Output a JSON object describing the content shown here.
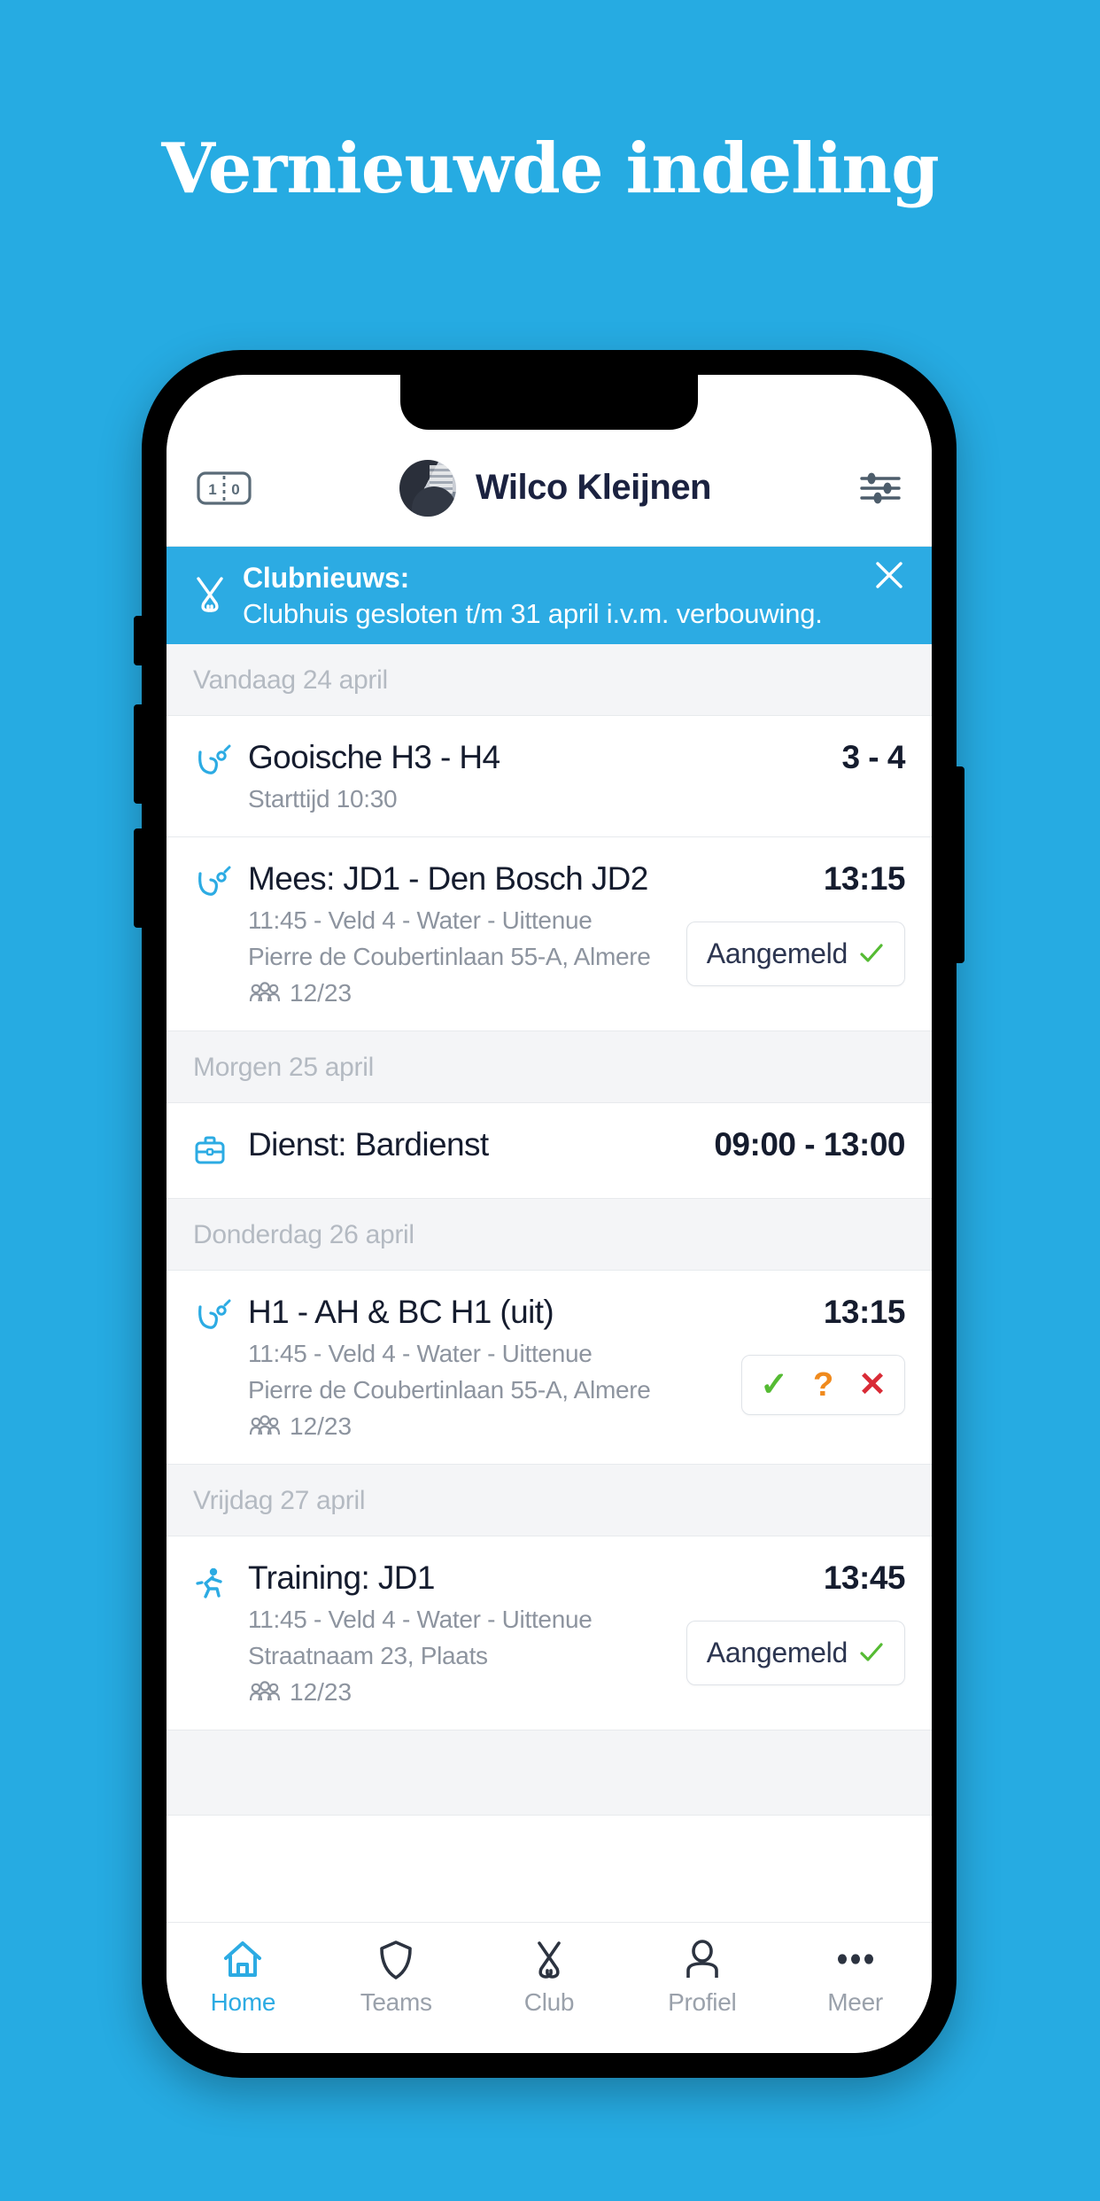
{
  "page": {
    "headline": "Vernieuwde indeling",
    "background_color": "#26ABE2"
  },
  "app": {
    "header": {
      "scoreboard_icon": "scoreboard-icon",
      "scoreboard_left": "1",
      "scoreboard_right": "0",
      "user_name": "Wilco Kleijnen",
      "avatar": "user-avatar",
      "settings_icon": "sliders-icon"
    },
    "banner": {
      "icon": "crossed-hockey-sticks-icon",
      "title": "Clubnieuws:",
      "message": "Clubhuis gesloten t/m 31 april i.v.m. verbouwing.",
      "close_icon": "close-icon",
      "color": "#2cabe3"
    },
    "sections": [
      {
        "day_label": "Vandaag 24 april",
        "events": [
          {
            "icon": "hockey-stick-icon",
            "title": "Gooische H3 - H4",
            "right_value": "3 - 4",
            "lines": [
              "Starttijd 10:30"
            ],
            "attendance": null,
            "status": null
          }
        ]
      },
      {
        "day_label": "",
        "events": [
          {
            "icon": "hockey-stick-icon",
            "title": "Mees: JD1 - Den Bosch JD2",
            "right_value": "13:15",
            "lines": [
              "11:45 - Veld 4 - Water - Uittenue",
              "Pierre de Coubertinlaan 55-A, Almere"
            ],
            "attendance": "12/23",
            "status": {
              "type": "signed_up",
              "label": "Aangemeld",
              "icon": "check-icon",
              "color": "#55bb33"
            }
          }
        ]
      },
      {
        "day_label": "Morgen 25 april",
        "events": [
          {
            "icon": "briefcase-icon",
            "title": "Dienst: Bardienst",
            "right_value": "09:00 - 13:00",
            "lines": [],
            "attendance": null,
            "status": null
          }
        ]
      },
      {
        "day_label": "Donderdag 26 april",
        "events": [
          {
            "icon": "hockey-stick-icon",
            "title": "H1 - AH & BC H1 (uit)",
            "right_value": "13:15",
            "lines": [
              "11:45 - Veld 4 - Water - Uittenue",
              "Pierre de Coubertinlaan 55-A, Almere"
            ],
            "attendance": "12/23",
            "status": {
              "type": "choice",
              "yes": "✓",
              "maybe": "?",
              "no": "✕",
              "yes_color": "#55bb33",
              "maybe_color": "#f08a1d",
              "no_color": "#d92b36"
            }
          }
        ]
      },
      {
        "day_label": "Vrijdag 27 april",
        "events": [
          {
            "icon": "running-icon",
            "title": "Training: JD1",
            "right_value": "13:45",
            "lines": [
              "11:45 - Veld 4 - Water - Uittenue",
              "Straatnaam 23, Plaats"
            ],
            "attendance": "12/23",
            "status": {
              "type": "signed_up",
              "label": "Aangemeld",
              "icon": "check-icon",
              "color": "#55bb33"
            }
          }
        ]
      }
    ],
    "tabbar": {
      "active_color": "#2cabe3",
      "items": [
        {
          "label": "Home",
          "icon": "home-icon",
          "active": true
        },
        {
          "label": "Teams",
          "icon": "shield-icon",
          "active": false
        },
        {
          "label": "Club",
          "icon": "crossed-sticks-icon",
          "active": false
        },
        {
          "label": "Profiel",
          "icon": "person-icon",
          "active": false
        },
        {
          "label": "Meer",
          "icon": "ellipsis-icon",
          "active": false
        }
      ]
    }
  }
}
